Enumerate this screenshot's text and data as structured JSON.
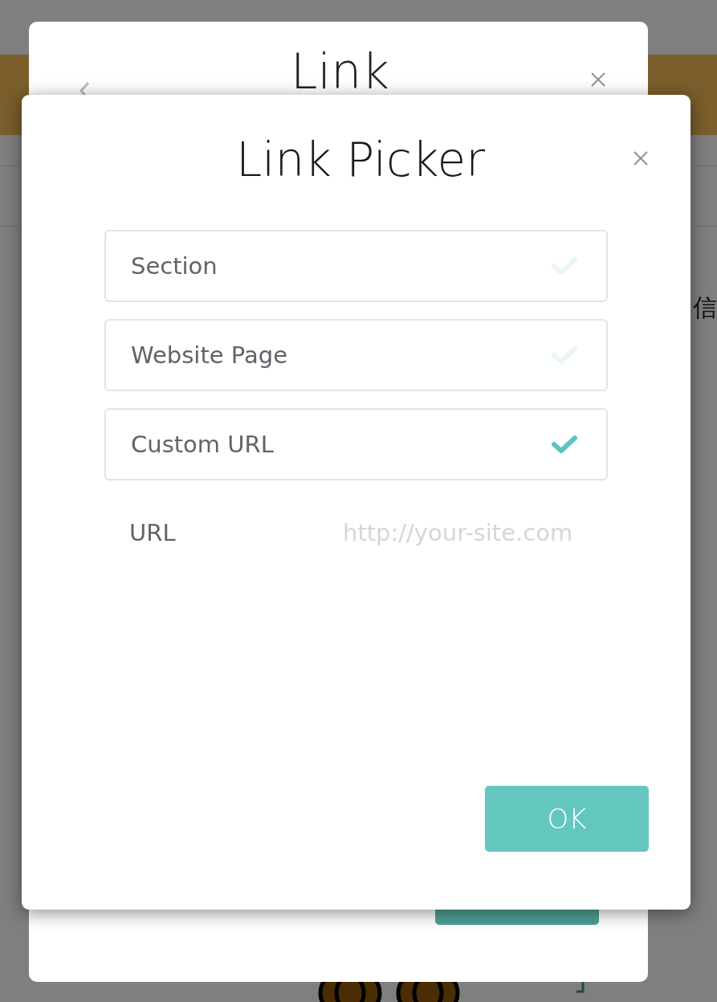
{
  "background": {
    "side_text": "信"
  },
  "back_dialog": {
    "title": "Link"
  },
  "link_picker": {
    "title": "Link Picker",
    "options": [
      {
        "label": "Section",
        "selected": false
      },
      {
        "label": "Website Page",
        "selected": false
      },
      {
        "label": "Custom URL",
        "selected": true
      }
    ],
    "url_field": {
      "label": "URL",
      "placeholder": "http://your-site.com"
    },
    "ok_button": "OK"
  }
}
